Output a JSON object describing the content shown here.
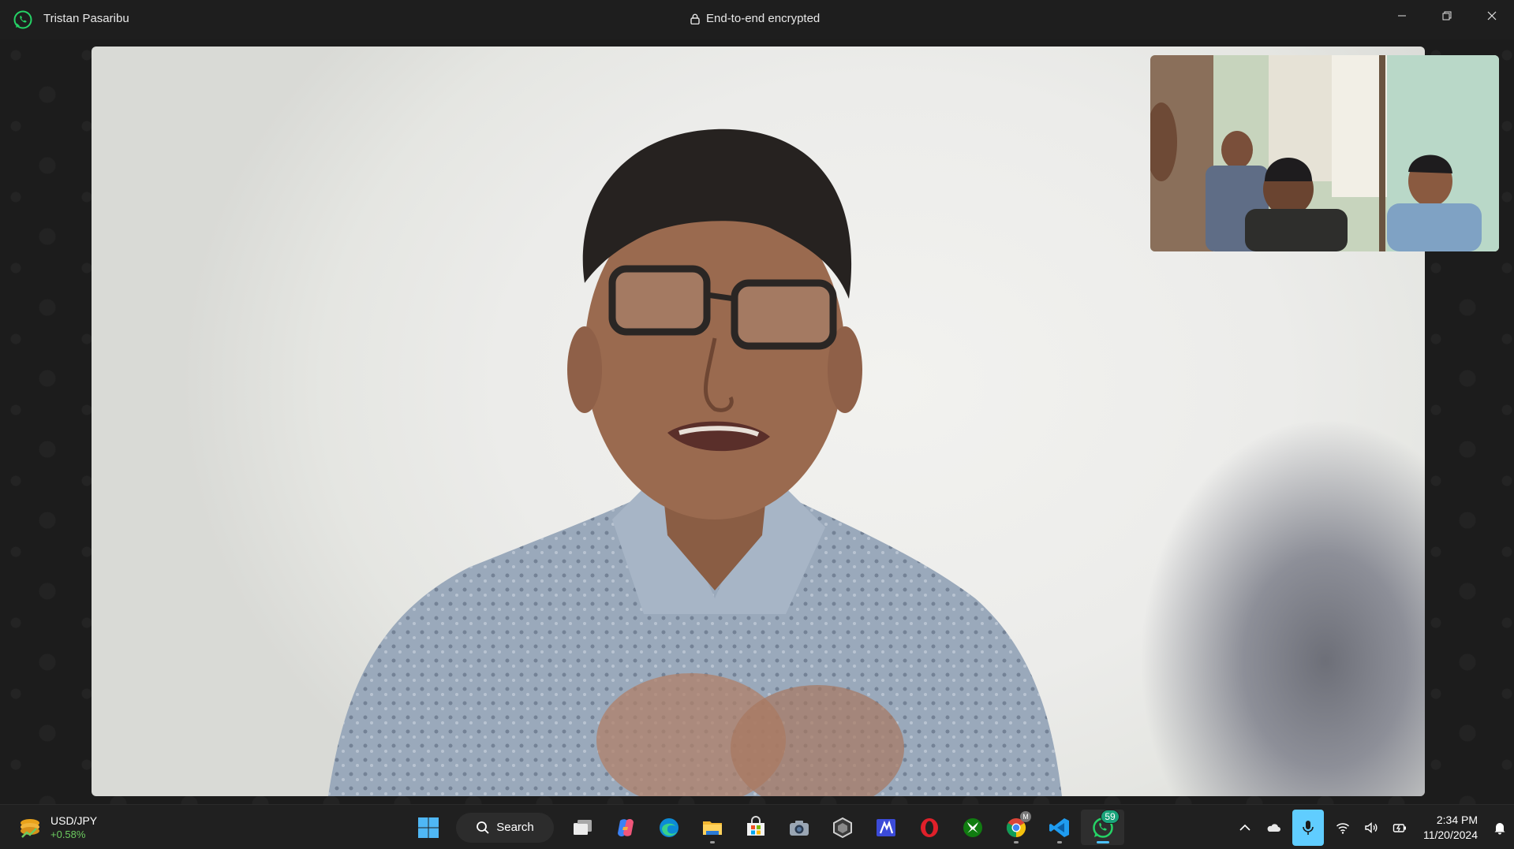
{
  "titlebar": {
    "contact_name": "Tristan Pasaribu",
    "encryption_label": "End-to-end encrypted",
    "controls": [
      "minimize",
      "restore",
      "close"
    ]
  },
  "call": {
    "main_video": "remote-participant-video",
    "self_view": "local-camera-preview"
  },
  "taskbar": {
    "widget": {
      "title": "USD/JPY",
      "change": "+0.58%",
      "change_color": "#6ccb5f"
    },
    "search_label": "Search",
    "pinned_apps": [
      {
        "name": "start-icon",
        "running": false
      },
      {
        "name": "task-view-icon",
        "running": false
      },
      {
        "name": "copilot-icon",
        "running": false
      },
      {
        "name": "edge-icon",
        "running": false
      },
      {
        "name": "file-explorer-icon",
        "running": true
      },
      {
        "name": "microsoft-store-icon",
        "running": false
      },
      {
        "name": "camera-icon",
        "running": false
      },
      {
        "name": "obs-icon",
        "running": false
      },
      {
        "name": "dev-app-icon",
        "running": false
      },
      {
        "name": "opera-icon",
        "running": false
      },
      {
        "name": "xbox-icon",
        "running": false
      },
      {
        "name": "chrome-icon",
        "running": true
      },
      {
        "name": "vscode-icon",
        "running": true
      },
      {
        "name": "whatsapp-icon",
        "running": true,
        "active": true
      }
    ],
    "whatsapp_badge": "59",
    "chrome_profile_badge": "M",
    "tray": {
      "icons": [
        "chevron-up-icon",
        "onedrive-icon",
        "microphone-icon",
        "wifi-icon",
        "volume-icon",
        "battery-icon"
      ],
      "time": "2:34 PM",
      "date": "11/20/2024",
      "accent": "#60cdff"
    }
  }
}
